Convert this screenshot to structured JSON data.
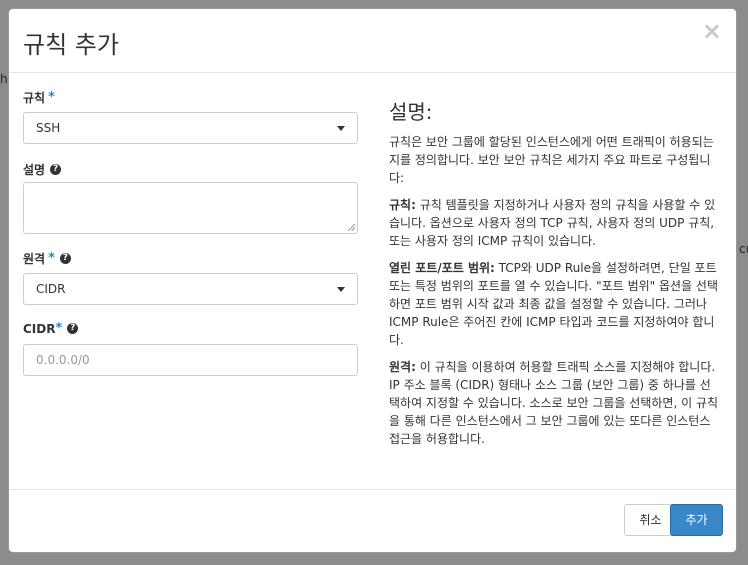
{
  "background": {
    "left_fragment": "h",
    "right_fragment": "cu"
  },
  "modal": {
    "title": "규칙 추가",
    "close_glyph": "×",
    "form": {
      "rule": {
        "label": "규칙",
        "required": "*",
        "selected": "SSH"
      },
      "description": {
        "label": "설명",
        "help": "?",
        "value": ""
      },
      "remote": {
        "label": "원격",
        "required": "*",
        "help": "?",
        "selected": "CIDR"
      },
      "cidr": {
        "label": "CIDR",
        "required": "*",
        "help": "?",
        "placeholder": "0.0.0.0/0"
      }
    },
    "help_panel": {
      "title": "설명:",
      "intro": "규칙은 보안 그룹에 할당된 인스턴스에게 어떤 트래픽이 허용되는지를 정의합니다. 보안 보안 규칙은 세가지 주요 파트로 구성됩니다:",
      "rule_term": "규칙:",
      "rule_text": " 규칙 템플릿을 지정하거나 사용자 정의 규칙을 사용할 수 있습니다. 옵션으로 사용자 정의 TCP 규칙, 사용자 정의 UDP 규칙, 또는 사용자 정의 ICMP 규칙이 있습니다.",
      "ports_term": "열린 포트/포트 범위:",
      "ports_text": " TCP와 UDP Rule을 설정하려면, 단일 포트 또는 특정 범위의 포트를 열 수 있습니다. \"포트 범위\" 옵션을 선택하면 포트 범위 시작 값과 최종 값을 설정할 수 있습니다. 그러나 ICMP Rule은 주어진 칸에 ICMP 타입과 코드를 지정하여야 합니다.",
      "remote_term": "원격:",
      "remote_text": " 이 규칙을 이용하여 허용할 트래픽 소스를 지정해야 합니다. IP 주소 블록 (CIDR) 형태나 소스 그룹 (보안 그룹) 중 하나를 선택하여 지정할 수 있습니다. 소스로 보안 그룹을 선택하면, 이 규칙을 통해 다른 인스턴스에서 그 보안 그룹에 있는 또다른 인스턴스 접근을 허용합니다."
    },
    "footer": {
      "cancel_label": "취소",
      "add_label": "추가"
    }
  }
}
